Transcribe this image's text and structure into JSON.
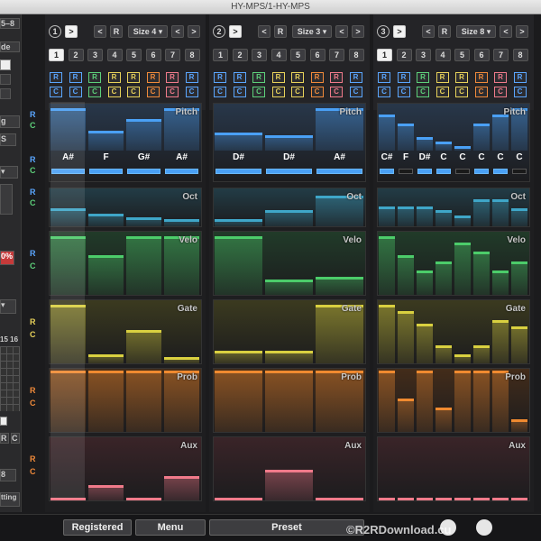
{
  "window": {
    "title": "HY-MPS/1-HY-MPS"
  },
  "left_panel": {
    "labels": [
      "5–8",
      "de",
      "g",
      "S",
      "0%",
      "tting",
      "8"
    ],
    "grid_labels": [
      "15",
      "16"
    ],
    "rc_bottom": [
      "R",
      "C"
    ]
  },
  "row_labels": {
    "r": "R",
    "c": "C"
  },
  "tracks": [
    {
      "number": "1",
      "next_label": ">",
      "prev_label": "<",
      "reset_label": "R",
      "size_label": "Size 4 ▾",
      "left_label": "<",
      "right_label": ">",
      "steps": [
        "1",
        "2",
        "3",
        "4",
        "5",
        "6",
        "7",
        "8"
      ],
      "active_step": 0,
      "rand_label": "R",
      "clear_label": "C",
      "pitch_notes": [
        "A#",
        "F",
        "G#",
        "A#"
      ],
      "step_count": 4,
      "lanes": {
        "pitch": {
          "name": "Pitch",
          "values": [
            0.95,
            0.45,
            0.7,
            0.95
          ]
        },
        "oct": {
          "name": "Oct",
          "values": [
            0.5,
            0.35,
            0.25,
            0.2
          ]
        },
        "velo": {
          "name": "Velo",
          "values": [
            0.95,
            0.65,
            0.95,
            0.95
          ]
        },
        "gate": {
          "name": "Gate",
          "values": [
            0.95,
            0.15,
            0.55,
            0.1
          ]
        },
        "prob": {
          "name": "Prob",
          "values": [
            1,
            1,
            1,
            1
          ]
        },
        "aux": {
          "name": "Aux",
          "values": [
            0.05,
            0.25,
            0.05,
            0.4
          ]
        }
      }
    },
    {
      "number": "2",
      "next_label": ">",
      "prev_label": "<",
      "reset_label": "R",
      "size_label": "Size 3 ▾",
      "left_label": "<",
      "right_label": ">",
      "steps": [
        "1",
        "2",
        "3",
        "4",
        "5",
        "6",
        "7",
        "8"
      ],
      "active_step": -1,
      "rand_label": "R",
      "clear_label": "C",
      "pitch_notes": [
        "D#",
        "D#",
        "A#"
      ],
      "step_count": 3,
      "lanes": {
        "pitch": {
          "name": "Pitch",
          "values": [
            0.4,
            0.35,
            0.95
          ]
        },
        "oct": {
          "name": "Oct",
          "values": [
            0.2,
            0.45,
            0.85
          ]
        },
        "velo": {
          "name": "Velo",
          "values": [
            0.95,
            0.25,
            0.3
          ]
        },
        "gate": {
          "name": "Gate",
          "values": [
            0.2,
            0.2,
            0.95
          ]
        },
        "prob": {
          "name": "Prob",
          "values": [
            1,
            1,
            1
          ]
        },
        "aux": {
          "name": "Aux",
          "values": [
            0.05,
            0.5,
            0.05
          ]
        }
      }
    },
    {
      "number": "3",
      "next_label": ">",
      "prev_label": "<",
      "reset_label": "R",
      "size_label": "Size 8 ▾",
      "left_label": "<",
      "right_label": ">",
      "steps": [
        "1",
        "2",
        "3",
        "4",
        "5",
        "6",
        "7",
        "8"
      ],
      "active_step": 0,
      "rand_label": "R",
      "clear_label": "C",
      "pitch_notes": [
        "C#",
        "F",
        "D#",
        "C",
        "C",
        "C",
        "C",
        "C"
      ],
      "step_count": 8,
      "lanes": {
        "pitch": {
          "name": "Pitch",
          "values": [
            0.8,
            0.6,
            0.3,
            0.2,
            0.1,
            0.6,
            0.8,
            0.95
          ]
        },
        "oct": {
          "name": "Oct",
          "values": [
            0.55,
            0.55,
            0.55,
            0.45,
            0.3,
            0.75,
            0.75,
            0.5
          ]
        },
        "velo": {
          "name": "Velo",
          "values": [
            0.95,
            0.65,
            0.4,
            0.55,
            0.85,
            0.7,
            0.4,
            0.55
          ]
        },
        "gate": {
          "name": "Gate",
          "values": [
            0.95,
            0.85,
            0.65,
            0.3,
            0.15,
            0.3,
            0.7,
            0.6
          ]
        },
        "prob": {
          "name": "Prob",
          "values": [
            1,
            0.55,
            1,
            0.4,
            1,
            1,
            1,
            0.2
          ]
        },
        "aux": {
          "name": "Aux",
          "values": [
            0.05,
            0.05,
            0.05,
            0.05,
            0.05,
            0.05,
            0.05,
            0.05
          ]
        }
      }
    }
  ],
  "bottom_bar": {
    "registered_label": "Registered",
    "menu_label": "Menu",
    "preset_label": "Preset"
  },
  "watermark": "©R2RDownload.cu",
  "colors": {
    "pitch": "#4aa0f5",
    "oct": "#3fa6c8",
    "velo": "#4ccc6a",
    "gate": "#d9d040",
    "prob": "#f08a30",
    "aux": "#f07a8a"
  }
}
